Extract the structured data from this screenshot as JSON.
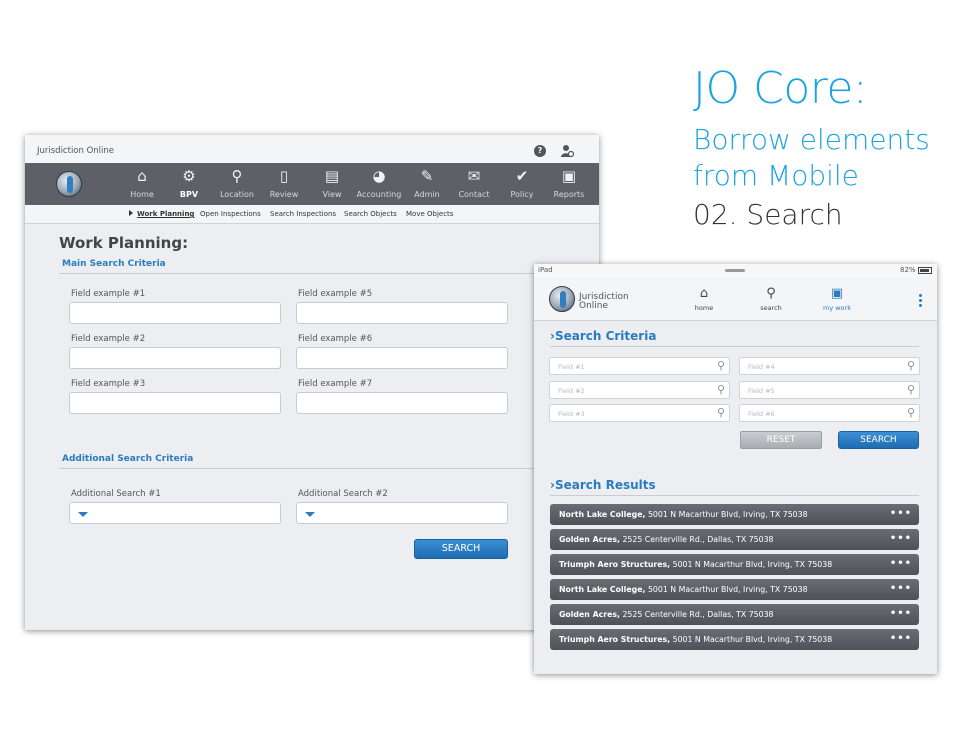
{
  "title": {
    "line1": "JO Core:",
    "line2": "Borrow elements",
    "line3": "from Mobile",
    "line4": "02. Search"
  },
  "desktop": {
    "app_name": "Jurisdiction Online",
    "nav": [
      {
        "label": "Home",
        "icon": "home-icon",
        "glyph": "⌂"
      },
      {
        "label": "BPV",
        "icon": "valve-icon",
        "glyph": "⚙"
      },
      {
        "label": "Location",
        "icon": "location-pin-icon",
        "glyph": "⚲"
      },
      {
        "label": "Review",
        "icon": "document-icon",
        "glyph": "▯"
      },
      {
        "label": "View",
        "icon": "view-document-icon",
        "glyph": "▤"
      },
      {
        "label": "Accounting",
        "icon": "pie-chart-icon",
        "glyph": "◕"
      },
      {
        "label": "Admin",
        "icon": "wrench-icon",
        "glyph": "✎"
      },
      {
        "label": "Contact",
        "icon": "mail-icon",
        "glyph": "✉"
      },
      {
        "label": "Policy",
        "icon": "check-circle-icon",
        "glyph": "✔"
      },
      {
        "label": "Reports",
        "icon": "clipboard-icon",
        "glyph": "▣"
      }
    ],
    "subnav": [
      "Work Planning",
      "Open Inspections",
      "Search Inspections",
      "Search Objects",
      "Move Objects"
    ],
    "page_title": "Work Planning:",
    "main_section": "Main Search Criteria",
    "fields": [
      "Field example #1",
      "Field example #2",
      "Field example #3",
      "Field example #5",
      "Field example #6",
      "Field example #7"
    ],
    "additional_section": "Additional Search Criteria",
    "additional": [
      "Additional Search #1",
      "Additional Search #2"
    ],
    "search_label": "SEARCH",
    "help_glyph": "?"
  },
  "tablet": {
    "device": "iPad",
    "battery": "82%",
    "brand_line1": "Jurisdiction",
    "brand_line2": "Online",
    "nav": [
      {
        "label": "home",
        "icon": "home-icon",
        "glyph": "⌂"
      },
      {
        "label": "search",
        "icon": "search-icon",
        "glyph": "⚲"
      },
      {
        "label": "my work",
        "icon": "briefcase-icon",
        "glyph": "▣"
      }
    ],
    "criteria_title": "›Search Criteria",
    "fields": [
      "Field #1",
      "Field #2",
      "Field #3",
      "Field #4",
      "Field #5",
      "Field #6"
    ],
    "reset_label": "RESET",
    "search_label": "SEARCH",
    "results_title": "›Search Results",
    "results": [
      {
        "name": "North Lake College,",
        "address": "5001 N Macarthur Blvd, Irving, TX 75038"
      },
      {
        "name": "Golden Acres,",
        "address": "2525 Centerville Rd., Dallas, TX 75038"
      },
      {
        "name": "Triumph Aero Structures,",
        "address": "5001 N Macarthur Blvd, Irving, TX 75038"
      },
      {
        "name": "North Lake College,",
        "address": "5001 N Macarthur Blvd, Irving, TX 75038"
      },
      {
        "name": "Golden Acres,",
        "address": "2525 Centerville Rd., Dallas, TX 75038"
      },
      {
        "name": "Triumph Aero Structures,",
        "address": "5001 N Macarthur Blvd, Irving, TX 75038"
      }
    ],
    "more_glyph": "•••"
  }
}
